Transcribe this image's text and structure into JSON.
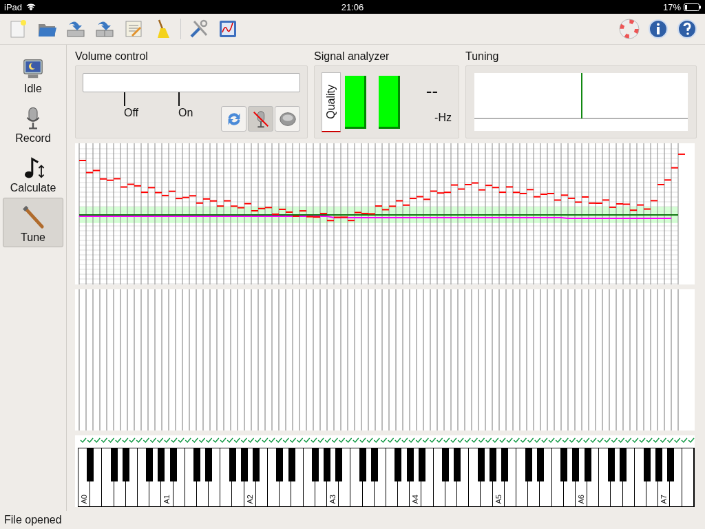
{
  "status_bar": {
    "carrier": "iPad",
    "time": "21:06",
    "battery": "17%"
  },
  "sidebar": {
    "items": [
      {
        "label": "Idle",
        "kind": "idle",
        "selected": false
      },
      {
        "label": "Record",
        "kind": "record",
        "selected": false
      },
      {
        "label": "Calculate",
        "kind": "calculate",
        "selected": false
      },
      {
        "label": "Tune",
        "kind": "tune",
        "selected": true
      }
    ]
  },
  "volume_control": {
    "title": "Volume control",
    "marks": [
      "Off",
      "On"
    ],
    "buttons": [
      {
        "kind": "refresh",
        "pressed": false
      },
      {
        "kind": "mic-off",
        "pressed": true
      },
      {
        "kind": "speaker",
        "pressed": false
      }
    ]
  },
  "signal_analyzer": {
    "title": "Signal analyzer",
    "quality_label": "Quality",
    "note": "--",
    "frequency": "-Hz"
  },
  "tuning": {
    "title": "Tuning"
  },
  "keyboard": {
    "octave_labels": [
      "A0",
      "A1",
      "A2",
      "A3",
      "A4",
      "A5",
      "A6",
      "A7"
    ]
  },
  "footer": {
    "message": "File opened"
  }
}
